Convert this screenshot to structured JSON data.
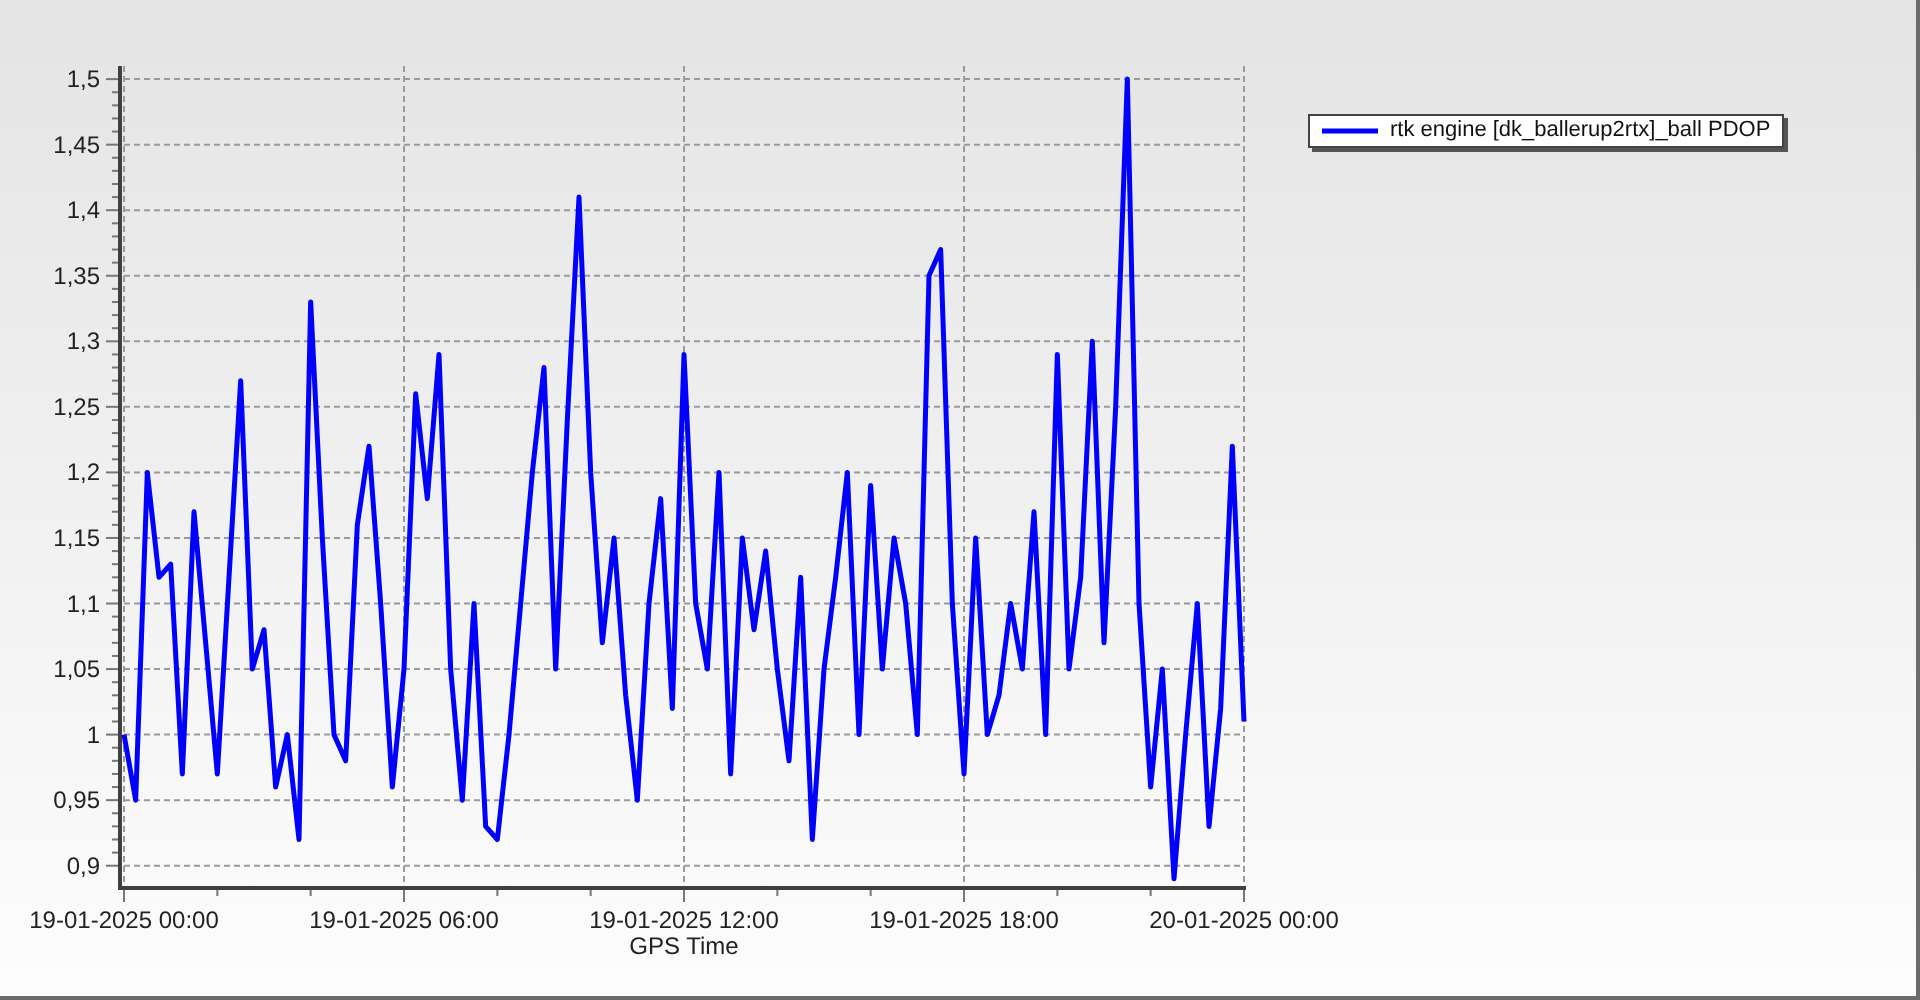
{
  "chart_data": {
    "type": "line",
    "grid": true,
    "xlabel": "GPS Time",
    "ylim": [
      0.883,
      1.51
    ],
    "yticks": [
      {
        "value": 0.9,
        "label": "0,9"
      },
      {
        "value": 0.95,
        "label": "0,95"
      },
      {
        "value": 1,
        "label": "1"
      },
      {
        "value": 1.05,
        "label": "1,05"
      },
      {
        "value": 1.1,
        "label": "1,1"
      },
      {
        "value": 1.15,
        "label": "1,15"
      },
      {
        "value": 1.2,
        "label": "1,2"
      },
      {
        "value": 1.25,
        "label": "1,25"
      },
      {
        "value": 1.3,
        "label": "1,3"
      },
      {
        "value": 1.35,
        "label": "1,35"
      },
      {
        "value": 1.4,
        "label": "1,4"
      },
      {
        "value": 1.45,
        "label": "1,45"
      },
      {
        "value": 1.5,
        "label": "1,5"
      }
    ],
    "categories": [
      "19-01-2025 00:00",
      null,
      null,
      null,
      null,
      null,
      null,
      null,
      null,
      null,
      null,
      null,
      null,
      null,
      null,
      null,
      null,
      null,
      null,
      null,
      null,
      null,
      null,
      null,
      "19-01-2025 06:00",
      null,
      null,
      null,
      null,
      null,
      null,
      null,
      null,
      null,
      null,
      null,
      null,
      null,
      null,
      null,
      null,
      null,
      null,
      null,
      null,
      null,
      null,
      null,
      "19-01-2025 12:00",
      null,
      null,
      null,
      null,
      null,
      null,
      null,
      null,
      null,
      null,
      null,
      null,
      null,
      null,
      null,
      null,
      null,
      null,
      null,
      null,
      null,
      null,
      null,
      "19-01-2025 18:00",
      null,
      null,
      null,
      null,
      null,
      null,
      null,
      null,
      null,
      null,
      null,
      null,
      null,
      null,
      null,
      null,
      null,
      null,
      null,
      null,
      null,
      null,
      null,
      "20-01-2025 00:00"
    ],
    "series": [
      {
        "name": "rtk engine [dk_ballerup2rtx]_ball PDOP",
        "color": "#0000ff",
        "values": [
          1.0,
          0.95,
          1.2,
          1.12,
          1.13,
          0.97,
          1.17,
          1.07,
          0.97,
          1.12,
          1.27,
          1.05,
          1.08,
          0.96,
          1.0,
          0.92,
          1.33,
          1.15,
          1.0,
          0.98,
          1.16,
          1.22,
          1.1,
          0.96,
          1.05,
          1.26,
          1.18,
          1.29,
          1.05,
          0.95,
          1.1,
          0.93,
          0.92,
          1.0,
          1.1,
          1.2,
          1.28,
          1.05,
          1.24,
          1.41,
          1.2,
          1.07,
          1.15,
          1.03,
          0.95,
          1.1,
          1.18,
          1.02,
          1.29,
          1.1,
          1.05,
          1.2,
          0.97,
          1.15,
          1.08,
          1.14,
          1.05,
          0.98,
          1.12,
          0.92,
          1.05,
          1.12,
          1.2,
          1.0,
          1.19,
          1.05,
          1.15,
          1.1,
          1.0,
          1.35,
          1.37,
          1.1,
          0.97,
          1.15,
          1.0,
          1.03,
          1.1,
          1.05,
          1.17,
          1.0,
          1.29,
          1.05,
          1.12,
          1.3,
          1.07,
          1.25,
          1.5,
          1.1,
          0.96,
          1.05,
          0.89,
          1.0,
          1.1,
          0.93,
          1.02,
          1.22,
          1.01
        ]
      }
    ]
  }
}
